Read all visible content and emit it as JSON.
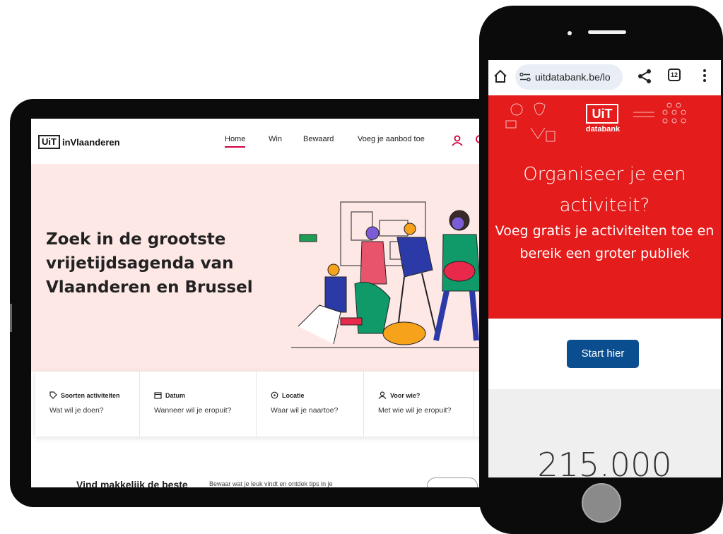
{
  "tablet": {
    "logo_box": "UiT",
    "logo_text": "inVlaanderen",
    "nav": [
      "Home",
      "Win",
      "Bewaard",
      "Voeg je aanbod toe"
    ],
    "hero_heading": "Zoek in de grootste vrijetijdsagenda van Vlaanderen en Brussel",
    "filters": [
      {
        "title": "Soorten activiteiten",
        "subtitle": "Wat wil je doen?",
        "icon": "tag-icon"
      },
      {
        "title": "Datum",
        "subtitle": "Wanneer wil je eropuit?",
        "icon": "calendar-icon"
      },
      {
        "title": "Locatie",
        "subtitle": "Waar wil je naartoe?",
        "icon": "location-pin-icon"
      },
      {
        "title": "Voor wie?",
        "subtitle": "Met wie wil je eropuit?",
        "icon": "user-icon"
      }
    ],
    "bottom_heading": "Vind makkelijk de beste",
    "bottom_text": "Bewaar wat je leuk vindt en ontdek tips in je",
    "accent": "#d0003d",
    "hero_bg": "#fde8e6"
  },
  "phone": {
    "url": "uitdatabank.be/lo",
    "tab_count": "12",
    "logo_box": "UiT",
    "logo_sub": "databank",
    "title": "Organiseer je een activiteit?",
    "subtitle": "Voeg gratis je activiteiten toe en bereik een groter publiek",
    "cta": "Start hier",
    "count": "215.000",
    "red": "#e41c1c",
    "cta_color": "#0b4e90"
  }
}
